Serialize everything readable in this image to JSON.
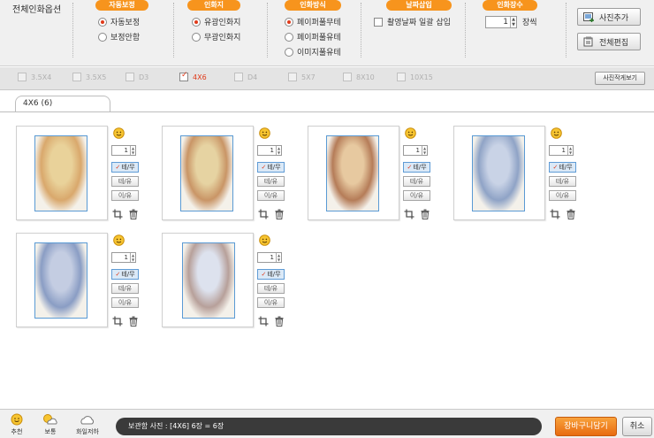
{
  "options": {
    "title": "전체인화옵션",
    "groups": [
      {
        "head": "자동보정",
        "items": [
          "자동보정",
          "보정안함"
        ],
        "selected": 0
      },
      {
        "head": "인화지",
        "items": [
          "유광인화지",
          "무광인화지"
        ],
        "selected": 0
      },
      {
        "head": "인화방식",
        "items": [
          "페이퍼풀무테",
          "페이퍼풀유테",
          "이미지풀유테"
        ],
        "selected": 0
      },
      {
        "head": "날짜삽입",
        "checkbox_label": "촬영날짜 일괄 삽입"
      },
      {
        "head": "인화장수",
        "count": "1",
        "unit": "장씩"
      }
    ],
    "add_photo_label": "사진추가",
    "edit_all_label": "전체편집"
  },
  "sizes": {
    "items": [
      "3.5X4",
      "3.5X5",
      "D3",
      "4X6",
      "D4",
      "5X7",
      "8X10",
      "10X15"
    ],
    "selected": "4X6",
    "view_button": "사진작게보기"
  },
  "tab": {
    "label": "4X6 (6)"
  },
  "photos": [
    {
      "qty": "1",
      "options": [
        "테/무",
        "테/유",
        "이/유"
      ],
      "selected": 0
    },
    {
      "qty": "1",
      "options": [
        "테/무",
        "테/유",
        "이/유"
      ],
      "selected": 0
    },
    {
      "qty": "1",
      "options": [
        "테/무",
        "테/유",
        "이/유"
      ],
      "selected": 0
    },
    {
      "qty": "1",
      "options": [
        "테/무",
        "테/유",
        "이/유"
      ],
      "selected": 0
    },
    {
      "qty": "1",
      "options": [
        "테/무",
        "테/유",
        "이/유"
      ],
      "selected": 0
    },
    {
      "qty": "1",
      "options": [
        "테/무",
        "테/유",
        "이/유"
      ],
      "selected": 0
    }
  ],
  "bottom": {
    "weather": [
      "추천",
      "보통",
      "화일저하"
    ],
    "status": "보관함 사진 : [4X6] 6장 = 6장",
    "cart_label": "장바구니담기",
    "cancel_label": "취소"
  },
  "colors": {
    "accent": "#f7941d",
    "selected_blue": "#5f9bd5",
    "check_red": "#e03a1a"
  }
}
